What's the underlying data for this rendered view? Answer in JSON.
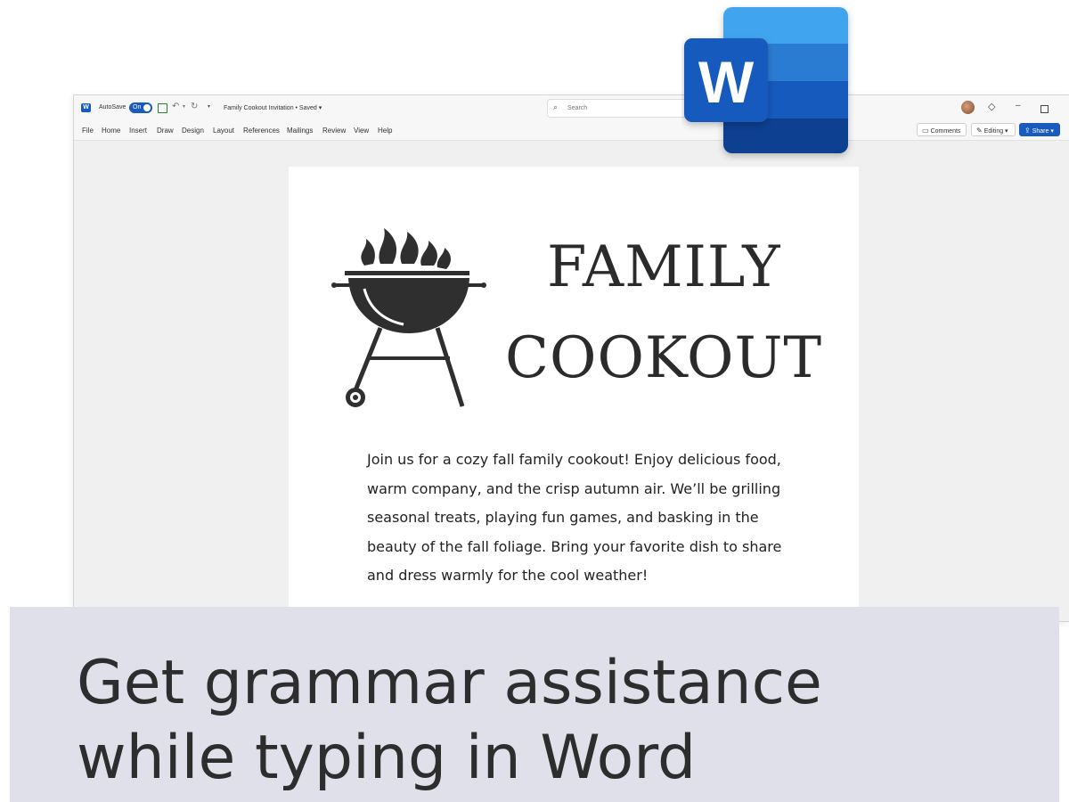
{
  "titlebar": {
    "autosave_label": "AutoSave",
    "autosave_state": "On",
    "document_title": "Family Cookout Invitation • Saved ▾",
    "search_placeholder": "Search"
  },
  "menu": {
    "items": [
      "File",
      "Home",
      "Insert",
      "Draw",
      "Design",
      "Layout",
      "References",
      "Mailings",
      "Review",
      "View",
      "Help"
    ]
  },
  "ribbon_actions": {
    "comments": "Comments",
    "editing": "Editing ▾",
    "share": "Share ▾"
  },
  "document": {
    "heading_line1": "FAMILY",
    "heading_line2": "COOKOUT",
    "body": "Join us for a cozy fall family cookout! Enjoy delicious food, warm company, and the crisp autumn air. We’ll be grilling seasonal treats, playing fun games, and basking in the beauty of the fall foliage. Bring your favorite dish to share and dress warmly for the cool weather!"
  },
  "logo": {
    "letter": "W",
    "colors": [
      "#41a5ee",
      "#2b7cd3",
      "#185abd",
      "#103f91"
    ]
  },
  "caption": {
    "line1": "Get grammar assistance",
    "line2": "while typing in Word"
  },
  "colors": {
    "accent": "#185abd",
    "caption_band": "#e0e0ea"
  },
  "icons": [
    "word-app-icon",
    "save-icon",
    "undo-icon",
    "redo-icon",
    "search-icon",
    "premium-diamond-icon",
    "minimize-icon",
    "maximize-icon",
    "comment-icon",
    "pencil-icon",
    "share-icon",
    "grill-icon"
  ]
}
